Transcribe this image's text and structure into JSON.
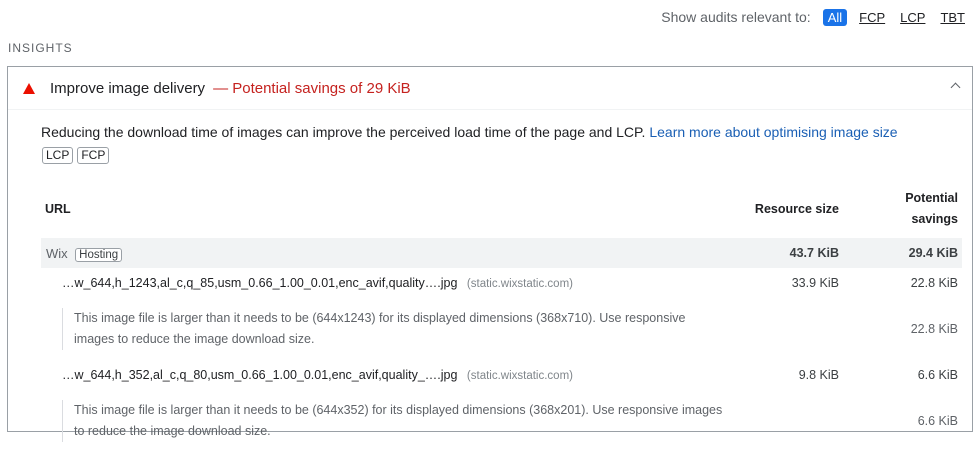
{
  "filter": {
    "label": "Show audits relevant to:",
    "chips": [
      "All",
      "FCP",
      "LCP",
      "TBT"
    ],
    "active": "All"
  },
  "section_title": "INSIGHTS",
  "audit": {
    "title": "Improve image delivery",
    "savings": "— Potential savings of 29 KiB",
    "description": "Reducing the download time of images can improve the perceived load time of the page and LCP.",
    "learn_more": "Learn more about optimising image size",
    "badges": [
      "LCP",
      "FCP"
    ],
    "status_color": "#eb0f00"
  },
  "table": {
    "headers": {
      "url": "URL",
      "resource_size": "Resource size",
      "potential_savings_1": "Potential",
      "potential_savings_2": "savings"
    },
    "group": {
      "entity": "Wix",
      "badge": "Hosting",
      "resource_size": "43.7 KiB",
      "savings": "29.4 KiB"
    },
    "items": [
      {
        "url": "…w_644,h_1243,al_c,q_85,usm_0.66_1.00_0.01,enc_avif,quality….jpg",
        "host": "(static.wixstatic.com)",
        "resource_size": "33.9 KiB",
        "savings": "22.8 KiB",
        "sub_text": "This image file is larger than it needs to be (644x1243) for its displayed dimensions (368x710). Use responsive images to reduce the image download size.",
        "sub_savings": "22.8 KiB"
      },
      {
        "url": "…w_644,h_352,al_c,q_80,usm_0.66_1.00_0.01,enc_avif,quality_….jpg",
        "host": "(static.wixstatic.com)",
        "resource_size": "9.8 KiB",
        "savings": "6.6 KiB",
        "sub_text": "This image file is larger than it needs to be (644x352) for its displayed dimensions (368x201). Use responsive images to reduce the image download size.",
        "sub_savings": "6.6 KiB"
      }
    ]
  }
}
